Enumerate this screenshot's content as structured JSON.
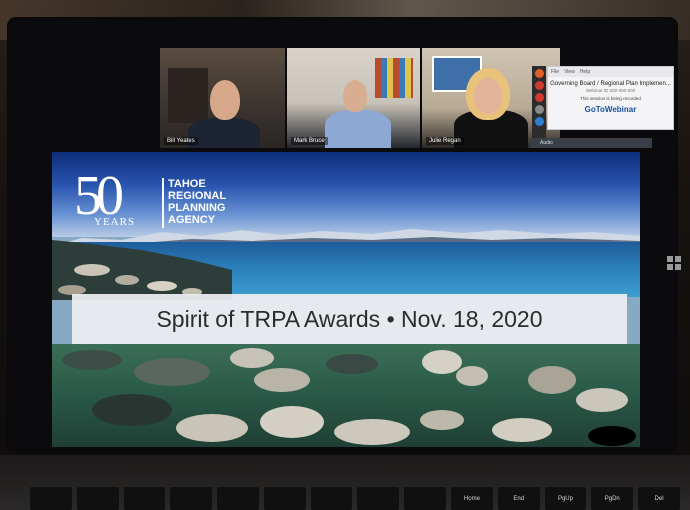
{
  "participants": [
    {
      "name": "Bill Yeates"
    },
    {
      "name": "Mark Bruce"
    },
    {
      "name": "Julie Regan"
    }
  ],
  "gotowebinar": {
    "menu": [
      "File",
      "View",
      "Help"
    ],
    "title": "Governing Board / Regional Plan Implemen...",
    "subtitle": "Webinar ID 000-000-000",
    "recording_notice": "This session is being recorded",
    "brand": "GoToWebinar",
    "audio_label": "Audio"
  },
  "slide": {
    "logo_number": "50",
    "logo_years": "YEARS",
    "logo_lines": [
      "TAHOE",
      "REGIONAL",
      "PLANNING",
      "AGENCY"
    ],
    "banner": "Spirit of TRPA Awards  •  Nov. 18, 2020"
  },
  "keyboard": {
    "keys": [
      "",
      "",
      "",
      "",
      "",
      "",
      "",
      "",
      "",
      "Home",
      "End",
      "PgUp",
      "PgDn",
      "Del"
    ]
  },
  "colors": {
    "sky": "#2a56b0",
    "lake": "#2a7db8",
    "banner_bg": "#ecedf0",
    "gtw_brand": "#1b4f9c"
  }
}
